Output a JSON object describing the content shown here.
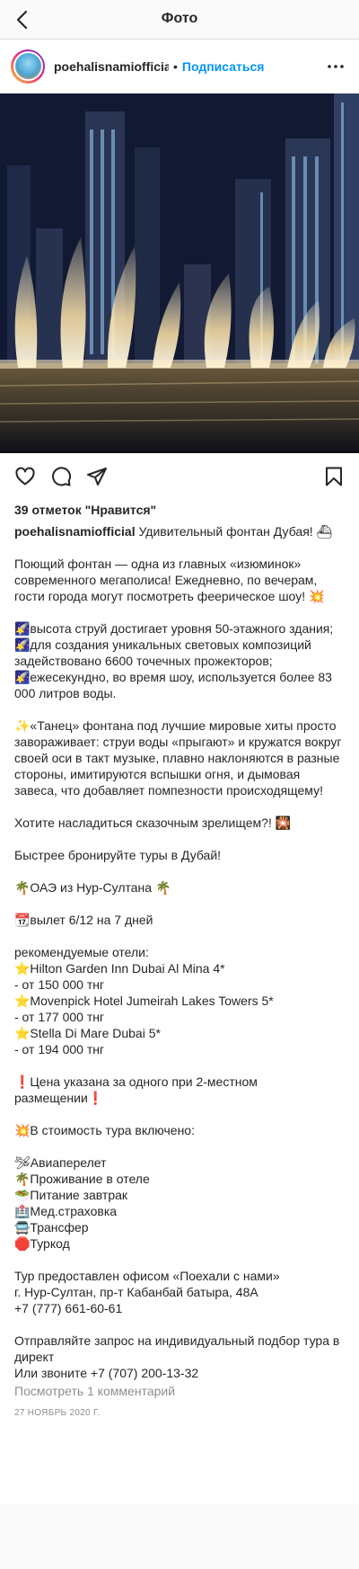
{
  "topbar": {
    "title": "Фото",
    "back_icon": "chevron-left-icon"
  },
  "header": {
    "username": "poehalisnamiofficial",
    "separator": "•",
    "follow_label": "Подписаться",
    "more_icon": "ellipsis-icon"
  },
  "actions": {
    "icons": [
      "heart-icon",
      "comment-icon",
      "share-icon",
      "bookmark-icon"
    ]
  },
  "likes": "39 отметок \"Нравится\"",
  "caption": {
    "username": "poehalisnamiofficial",
    "text": " Удивительный фонтан Дубая! ⛴\n\nПоющий фонтан — одна из главных «изюминок» современного мегаполиса! Ежедневно, по вечерам, гости города могут посмотреть феерическое шоу! 💥\n\n🌠высота струй достигает уровня 50-этажного здания;\n🌠для создания уникальных световых композиций задействовано 6600 точечных прожекторов;\n🌠ежесекундно, во время шоу, используется более 83 000 литров воды.\n\n✨«Танец» фонтана под лучшие мировые хиты просто завораживает: струи воды «прыгают» и кружатся вокруг своей оси в такт музыке, плавно наклоняются в разные стороны, имитируются вспышки огня, и дымовая завеса, что добавляет помпезности происходящему!\n\nХотите насладиться сказочным зрелищем?! 🎇\n\nБыстрее бронируйте туры в Дубай!\n\n🌴ОАЭ из Нур-Султана 🌴\n\n📆вылет 6/12 на 7 дней\n\nрекомендуемые отели:\n⭐Hilton Garden Inn Dubai Al Mina 4*\n- от 150 000 тнг\n⭐Movenpick Hotel Jumeirah Lakes Towers 5*\n- от 177 000 тнг\n⭐Stella Di Mare Dubai 5*\n- от 194 000 тнг\n\n❗Цена указана за одного при 2-местном размещении❗\n\n💥В стоимость тура включено:\n\n🛩Авиаперелет\n🌴Проживание в отеле\n🥗Питание завтрак\n🏥Мед.страховка\n🚍Трансфер\n🛑Туркод\n\nТур предоставлен офисом «Поехали с нами»\nг. Нур-Султан, пр-т Кабанбай батыра, 48А\n+7 (777) 661-60-61\n\nОтправляйте запрос на индивидуальный подбор тура в директ\nИли звоните +7 (707) 200-13-32"
  },
  "comments_link": "Посмотреть 1 комментарий",
  "date": "27 НОЯБРЬ 2020 Г.",
  "colors": {
    "accent": "#0095f6",
    "text": "#262626",
    "muted": "#8e8e8e"
  }
}
